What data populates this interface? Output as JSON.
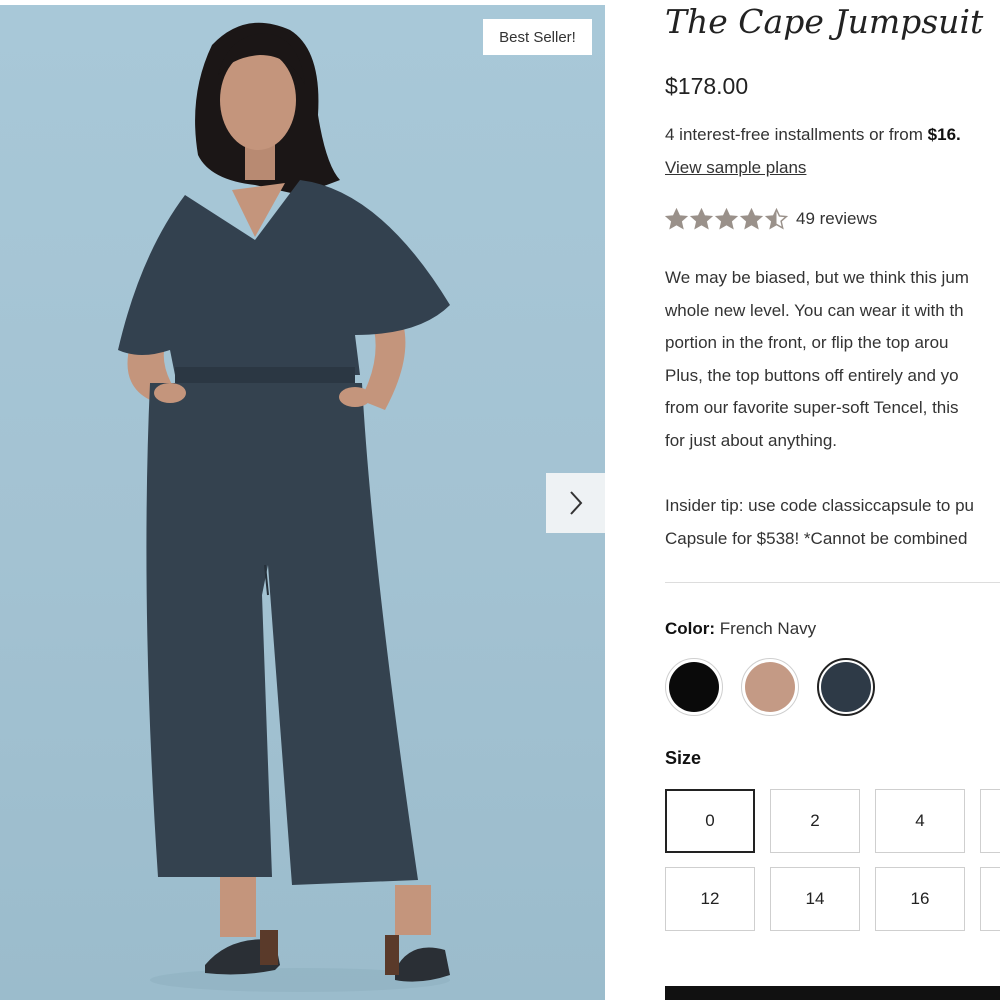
{
  "image": {
    "badge": "Best Seller!",
    "next_icon": "chevron-right-icon"
  },
  "product": {
    "title": "The Cape Jumpsuit",
    "price": "$178.00",
    "installments_prefix": "4 interest-free installments or from ",
    "installments_amount": "$16.",
    "sample_plans_link": "View sample plans",
    "rating": 4.5,
    "reviews": "49 reviews",
    "description_lines": [
      "We may be biased, but we think this jum",
      "whole new level. You can wear it with th",
      "portion in the front, or flip the top arou",
      "Plus, the top buttons off entirely and yo",
      "from our favorite super-soft Tencel, this",
      "for just about anything."
    ],
    "tip_lines": [
      "Insider tip: use code classiccapsule to pu",
      "Capsule for $538! *Cannot be combined"
    ]
  },
  "color": {
    "label": "Color:",
    "selected": "French Navy",
    "swatches": [
      {
        "color": "#0a0a0a"
      },
      {
        "color": "#c49a85"
      },
      {
        "color": "#2e3a47"
      }
    ]
  },
  "size": {
    "label": "Size",
    "options": [
      "0",
      "2",
      "4",
      "",
      "12",
      "14",
      "16",
      ""
    ],
    "selected": "0"
  }
}
